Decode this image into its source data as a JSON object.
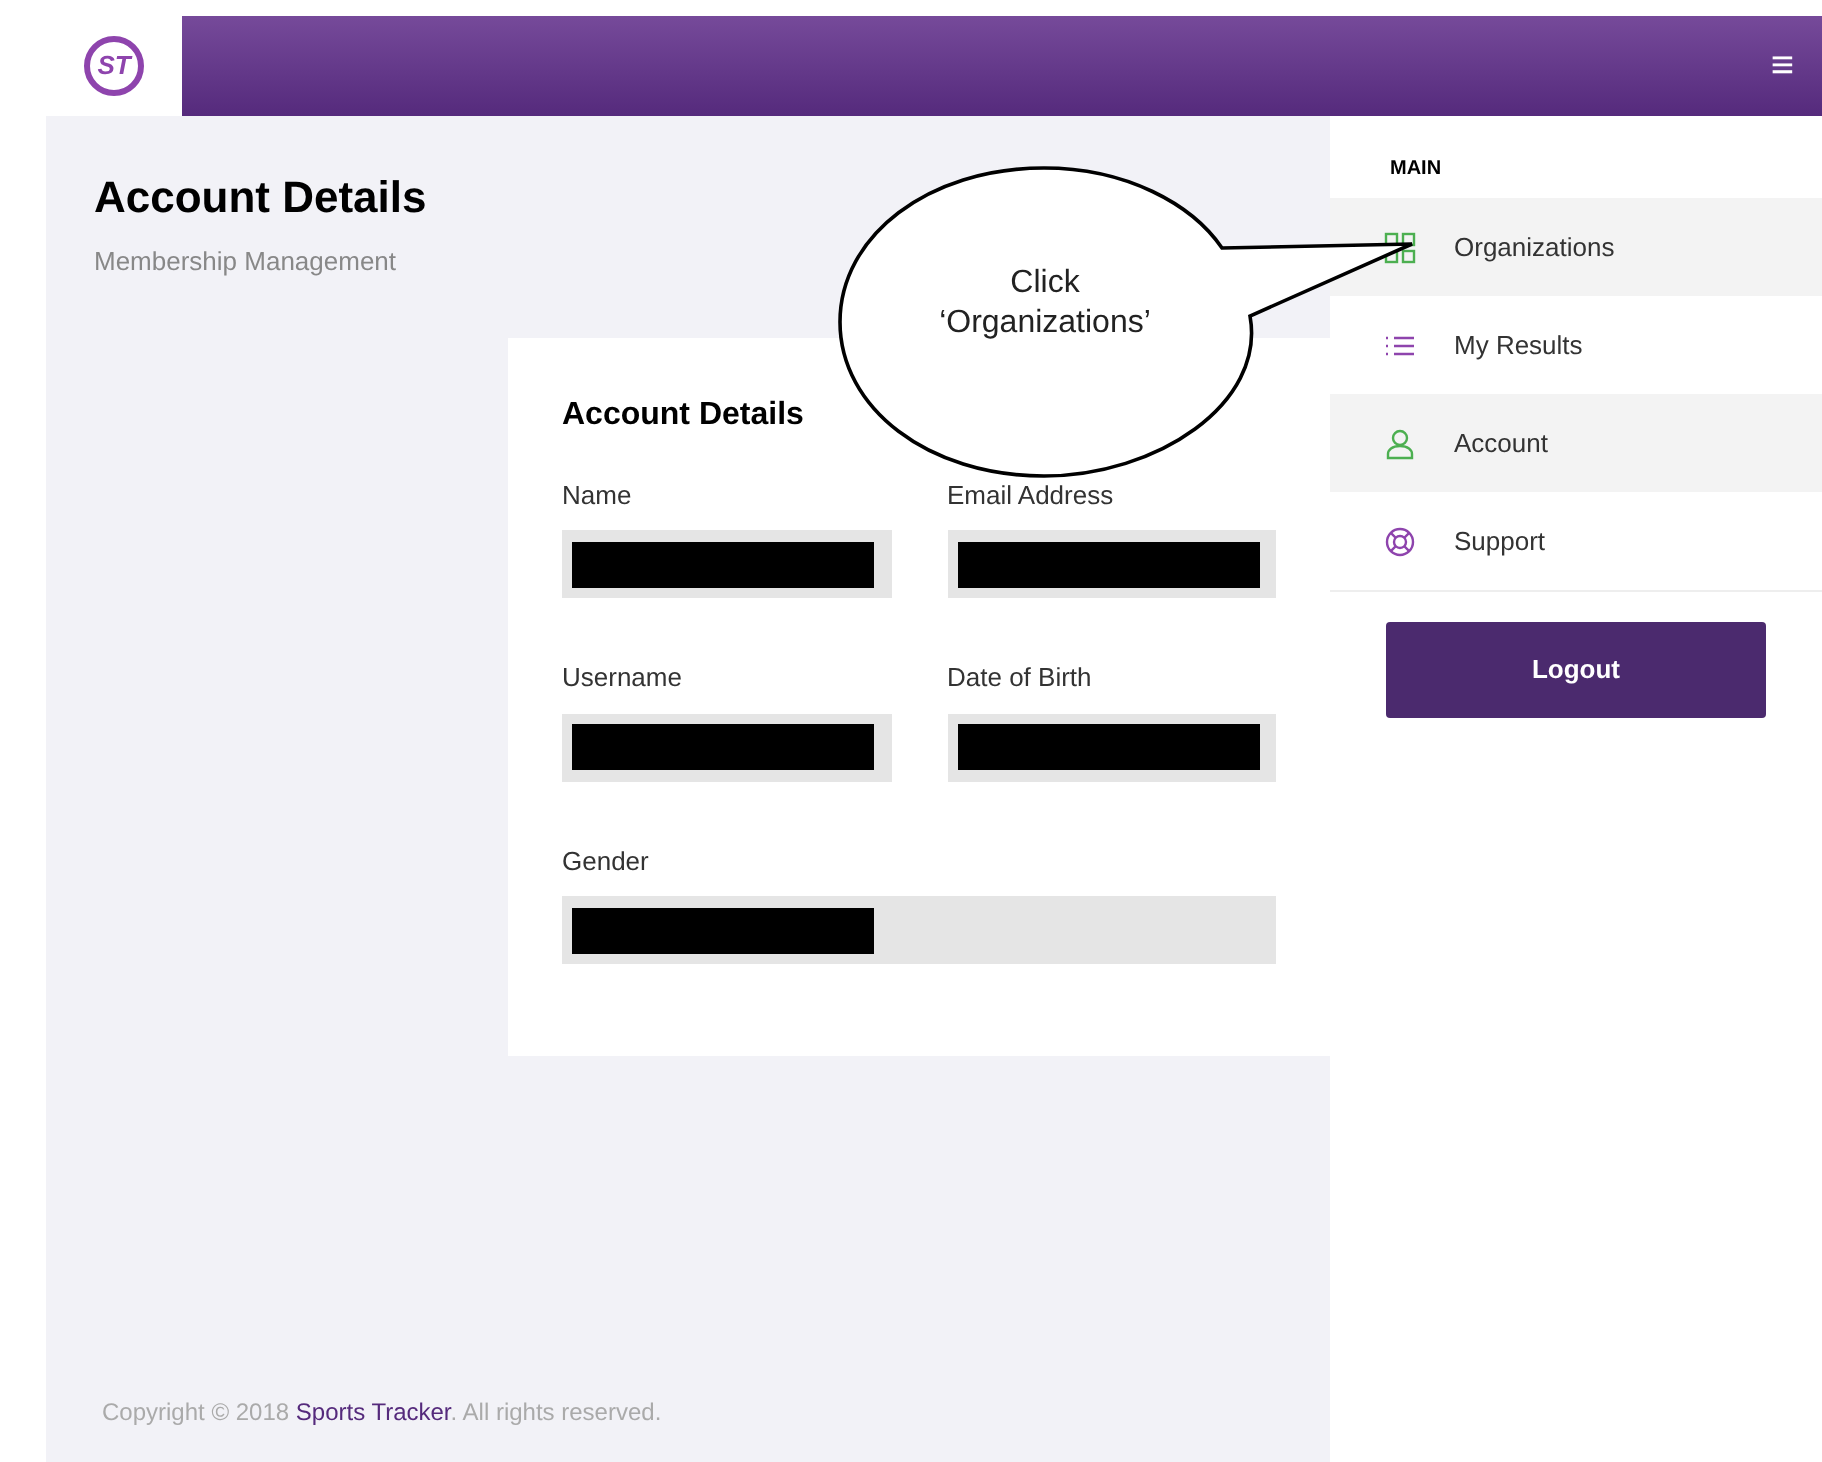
{
  "header": {
    "logo_text": "ST",
    "menu_icon": "≡"
  },
  "page": {
    "title": "Account Details",
    "subtitle": "Membership Management"
  },
  "card": {
    "title": "Account Details",
    "fields": [
      {
        "label": "Name",
        "redacted": true,
        "kind": "half"
      },
      {
        "label": "Email Address",
        "redacted": true,
        "kind": "half"
      },
      {
        "label": "Username",
        "redacted": true,
        "kind": "half"
      },
      {
        "label": "Date of Birth",
        "redacted": true,
        "kind": "half"
      },
      {
        "label": "Gender",
        "redacted": true,
        "kind": "full"
      }
    ]
  },
  "sidebar": {
    "section": "MAIN",
    "items": [
      {
        "label": "Organizations",
        "kind": "grid",
        "color": "#4caf50",
        "highlighted": true
      },
      {
        "label": "My Results",
        "kind": "list",
        "color": "#8e44ad",
        "highlighted": false
      },
      {
        "label": "Account",
        "kind": "user",
        "color": "#4caf50",
        "highlighted": true
      },
      {
        "label": "Support",
        "kind": "lifebuoy",
        "color": "#8e44ad",
        "highlighted": false
      }
    ],
    "logout": "Logout"
  },
  "callout": {
    "lines": [
      "Click",
      "‘Organizations’"
    ]
  },
  "footer": {
    "before": "Copyright © 2018 ",
    "link": "Sports Tracker",
    "after": ". All rights reserved."
  }
}
